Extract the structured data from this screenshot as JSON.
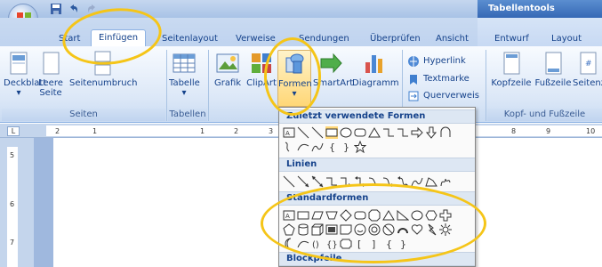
{
  "window": {
    "context_title": "Tabellentools"
  },
  "tabs": [
    {
      "label": "Start"
    },
    {
      "label": "Einfügen"
    },
    {
      "label": "Seitenlayout"
    },
    {
      "label": "Verweise"
    },
    {
      "label": "Sendungen"
    },
    {
      "label": "Überprüfen"
    },
    {
      "label": "Ansicht"
    }
  ],
  "context_tabs": [
    {
      "label": "Entwurf"
    },
    {
      "label": "Layout"
    }
  ],
  "ribbon": {
    "seiten": {
      "label": "Seiten",
      "deckblatt": "Deckblatt",
      "leere_seite_1": "Leere",
      "leere_seite_2": "Seite",
      "seitenumbruch": "Seitenumbruch"
    },
    "tabellen": {
      "label": "Tabellen",
      "tabelle": "Tabelle"
    },
    "illustrationen": {
      "grafik": "Grafik",
      "clipart": "ClipArt",
      "formen": "Formen",
      "smartart": "SmartArt",
      "diagramm": "Diagramm"
    },
    "hyperlinks": {
      "hyperlink": "Hyperlink",
      "textmarke": "Textmarke",
      "querverweis": "Querverweis"
    },
    "kopf": {
      "label": "Kopf- und Fußzeile",
      "kopfzeile": "Kopfzeile",
      "fusszeile": "Fußzeile",
      "seitenzahl": "Seitenz"
    }
  },
  "ruler": {
    "h_marks": [
      "2",
      "1",
      "1",
      "2",
      "3",
      "8",
      "9",
      "10"
    ],
    "v_marks": [
      "5",
      "6",
      "7"
    ],
    "tab_selector": "L"
  },
  "dropdown": {
    "sections": [
      {
        "title": "Zuletzt verwendete Formen"
      },
      {
        "title": "Linien"
      },
      {
        "title": "Standardformen"
      },
      {
        "title": "Blockpfeile"
      }
    ]
  },
  "colors": {
    "highlight": "#f5c518",
    "accent": "#15428b"
  }
}
